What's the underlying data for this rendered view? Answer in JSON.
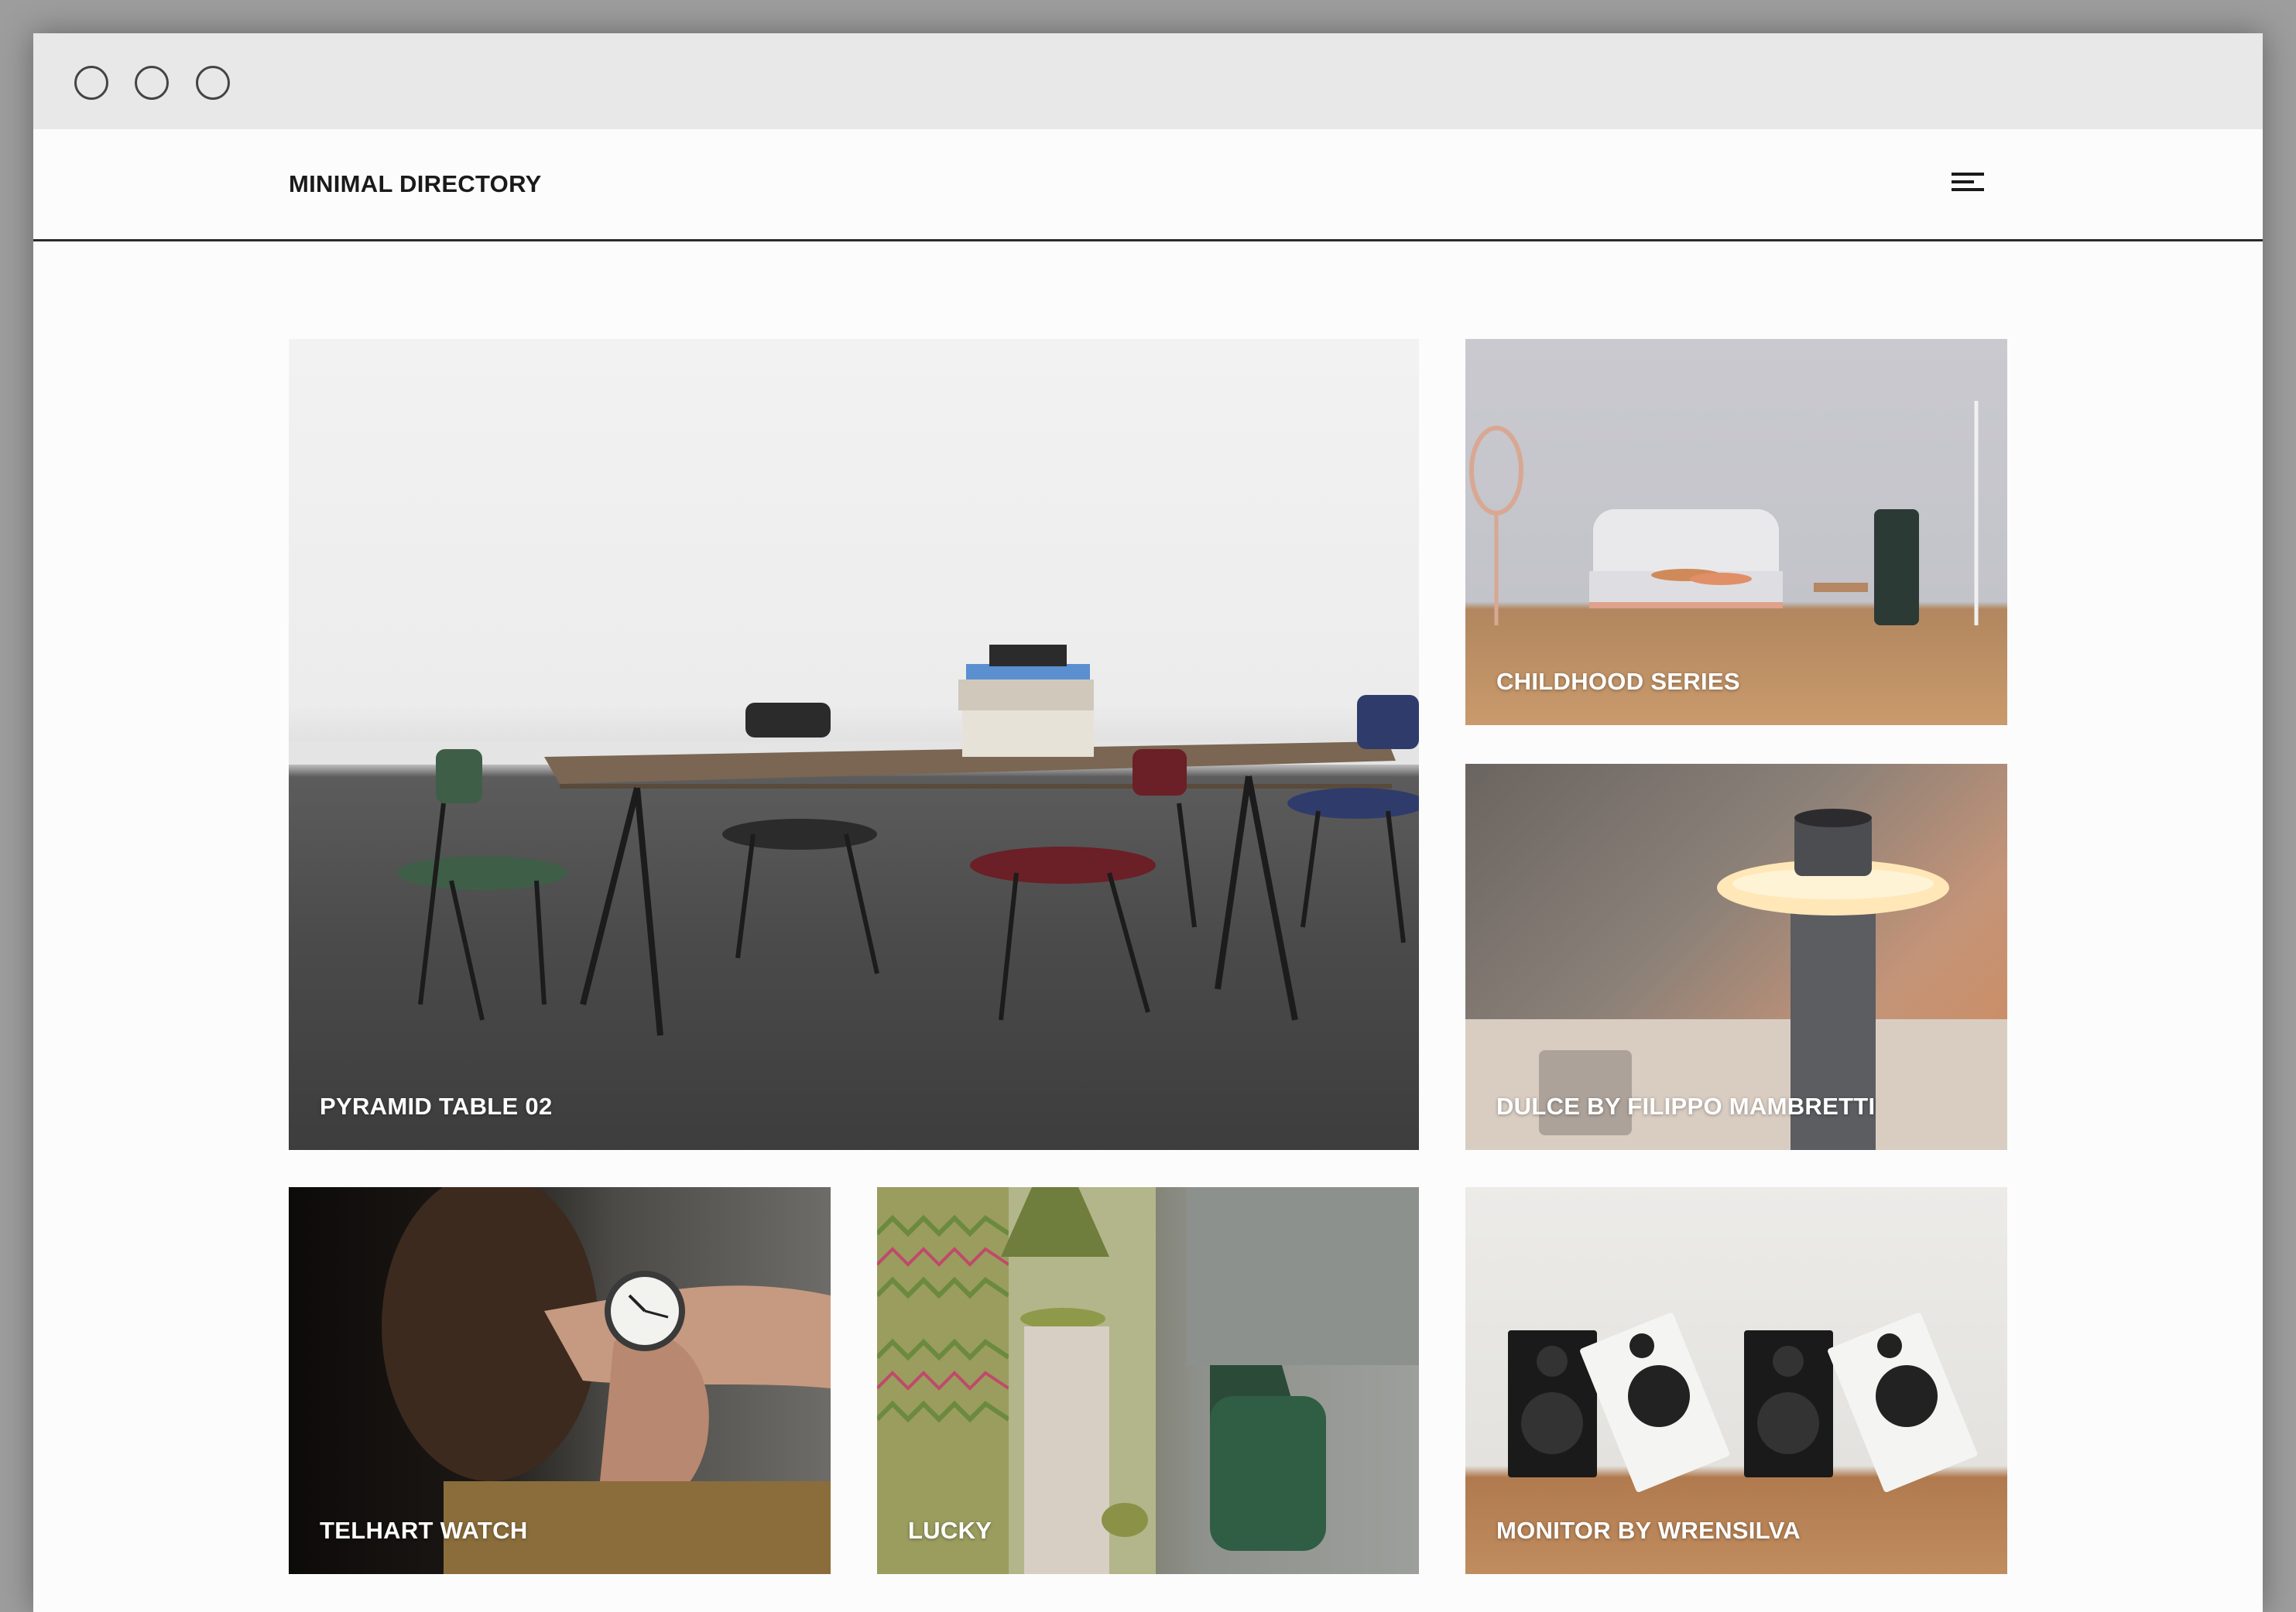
{
  "window": {
    "controls": [
      "close-dot",
      "minimize-dot",
      "zoom-dot"
    ]
  },
  "header": {
    "logo": "MINIMAL DIRECTORY",
    "menu_icon": "hamburger-menu-icon"
  },
  "grid": {
    "items": [
      {
        "label": "PYRAMID TABLE 02"
      },
      {
        "label": "CHILDHOOD SERIES"
      },
      {
        "label": "DULCE BY FILIPPO MAMBRETTI"
      },
      {
        "label": "TELHART WATCH"
      },
      {
        "label": "LUCKY"
      },
      {
        "label": "MONITOR BY WRENSILVA"
      }
    ]
  },
  "colors": {
    "page_background": "#fcfcfc",
    "titlebar": "#e8e8e8",
    "text": "#1a1a1a",
    "label_text": "#ffffff"
  }
}
